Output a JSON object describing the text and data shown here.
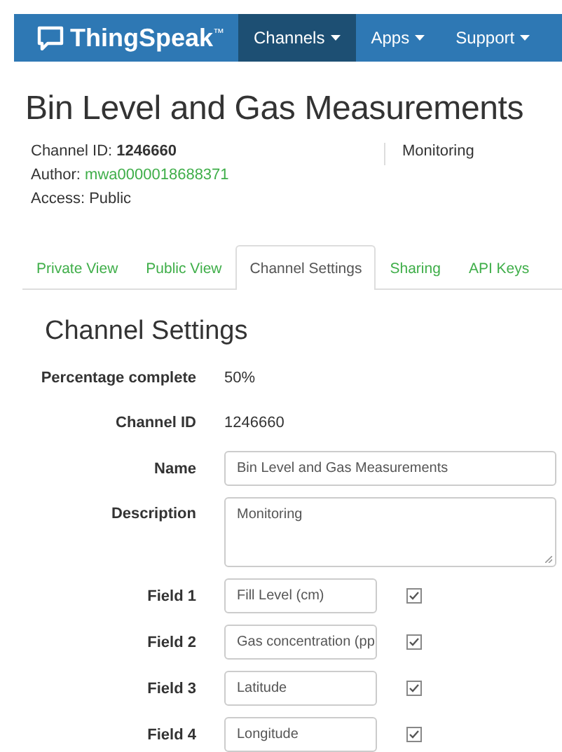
{
  "navbar": {
    "brand": "ThingSpeak",
    "trademark": "™",
    "items": [
      {
        "label": "Channels",
        "selected": true
      },
      {
        "label": "Apps",
        "selected": false
      },
      {
        "label": "Support",
        "selected": false
      }
    ]
  },
  "channel": {
    "title": "Bin Level and Gas Measurements",
    "id_label": "Channel ID:",
    "id": "1246660",
    "author_label": "Author:",
    "author": "mwa0000018688371",
    "access": "Access: Public",
    "description": "Monitoring"
  },
  "tabs": [
    {
      "label": "Private View",
      "selected": false
    },
    {
      "label": "Public View",
      "selected": false
    },
    {
      "label": "Channel Settings",
      "selected": true
    },
    {
      "label": "Sharing",
      "selected": false
    },
    {
      "label": "API Keys",
      "selected": false
    }
  ],
  "settings": {
    "heading": "Channel Settings",
    "rows": [
      {
        "kind": "text",
        "label": "Percentage complete",
        "value": "50%"
      },
      {
        "kind": "text",
        "label": "Channel ID",
        "value": "1246660"
      },
      {
        "kind": "input",
        "label": "Name",
        "value": "Bin Level and Gas Measurements"
      },
      {
        "kind": "textarea",
        "label": "Description",
        "value": "Monitoring"
      },
      {
        "kind": "field",
        "label": "Field 1",
        "value": "Fill Level (cm)",
        "checked": true
      },
      {
        "kind": "field",
        "label": "Field 2",
        "value": "Gas concentration (pp",
        "checked": true
      },
      {
        "kind": "field",
        "label": "Field 3",
        "value": "Latitude",
        "checked": true
      },
      {
        "kind": "field",
        "label": "Field 4",
        "value": "Longitude",
        "checked": true
      }
    ]
  }
}
